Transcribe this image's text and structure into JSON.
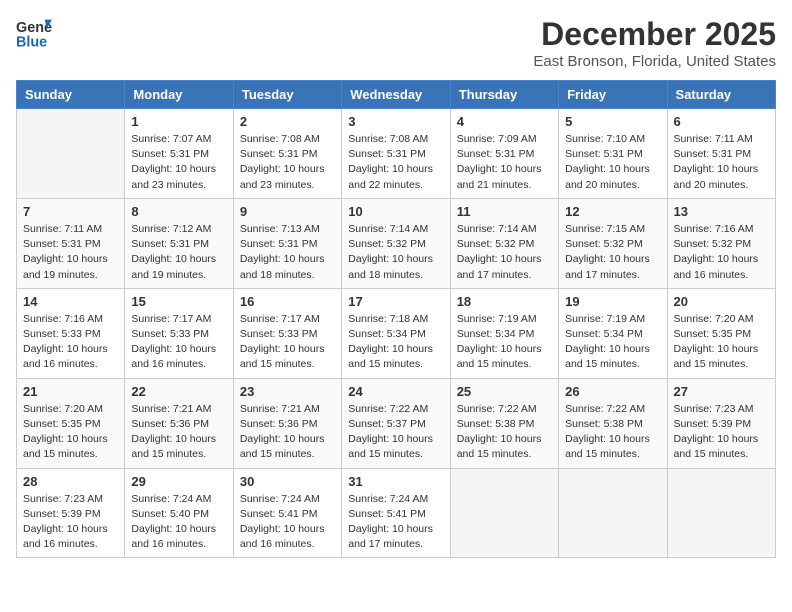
{
  "header": {
    "logo_line1": "General",
    "logo_line2": "Blue",
    "month": "December 2025",
    "location": "East Bronson, Florida, United States"
  },
  "days_of_week": [
    "Sunday",
    "Monday",
    "Tuesday",
    "Wednesday",
    "Thursday",
    "Friday",
    "Saturday"
  ],
  "weeks": [
    [
      {
        "num": "",
        "detail": ""
      },
      {
        "num": "1",
        "detail": "Sunrise: 7:07 AM\nSunset: 5:31 PM\nDaylight: 10 hours\nand 23 minutes."
      },
      {
        "num": "2",
        "detail": "Sunrise: 7:08 AM\nSunset: 5:31 PM\nDaylight: 10 hours\nand 23 minutes."
      },
      {
        "num": "3",
        "detail": "Sunrise: 7:08 AM\nSunset: 5:31 PM\nDaylight: 10 hours\nand 22 minutes."
      },
      {
        "num": "4",
        "detail": "Sunrise: 7:09 AM\nSunset: 5:31 PM\nDaylight: 10 hours\nand 21 minutes."
      },
      {
        "num": "5",
        "detail": "Sunrise: 7:10 AM\nSunset: 5:31 PM\nDaylight: 10 hours\nand 20 minutes."
      },
      {
        "num": "6",
        "detail": "Sunrise: 7:11 AM\nSunset: 5:31 PM\nDaylight: 10 hours\nand 20 minutes."
      }
    ],
    [
      {
        "num": "7",
        "detail": "Sunrise: 7:11 AM\nSunset: 5:31 PM\nDaylight: 10 hours\nand 19 minutes."
      },
      {
        "num": "8",
        "detail": "Sunrise: 7:12 AM\nSunset: 5:31 PM\nDaylight: 10 hours\nand 19 minutes."
      },
      {
        "num": "9",
        "detail": "Sunrise: 7:13 AM\nSunset: 5:31 PM\nDaylight: 10 hours\nand 18 minutes."
      },
      {
        "num": "10",
        "detail": "Sunrise: 7:14 AM\nSunset: 5:32 PM\nDaylight: 10 hours\nand 18 minutes."
      },
      {
        "num": "11",
        "detail": "Sunrise: 7:14 AM\nSunset: 5:32 PM\nDaylight: 10 hours\nand 17 minutes."
      },
      {
        "num": "12",
        "detail": "Sunrise: 7:15 AM\nSunset: 5:32 PM\nDaylight: 10 hours\nand 17 minutes."
      },
      {
        "num": "13",
        "detail": "Sunrise: 7:16 AM\nSunset: 5:32 PM\nDaylight: 10 hours\nand 16 minutes."
      }
    ],
    [
      {
        "num": "14",
        "detail": "Sunrise: 7:16 AM\nSunset: 5:33 PM\nDaylight: 10 hours\nand 16 minutes."
      },
      {
        "num": "15",
        "detail": "Sunrise: 7:17 AM\nSunset: 5:33 PM\nDaylight: 10 hours\nand 16 minutes."
      },
      {
        "num": "16",
        "detail": "Sunrise: 7:17 AM\nSunset: 5:33 PM\nDaylight: 10 hours\nand 15 minutes."
      },
      {
        "num": "17",
        "detail": "Sunrise: 7:18 AM\nSunset: 5:34 PM\nDaylight: 10 hours\nand 15 minutes."
      },
      {
        "num": "18",
        "detail": "Sunrise: 7:19 AM\nSunset: 5:34 PM\nDaylight: 10 hours\nand 15 minutes."
      },
      {
        "num": "19",
        "detail": "Sunrise: 7:19 AM\nSunset: 5:34 PM\nDaylight: 10 hours\nand 15 minutes."
      },
      {
        "num": "20",
        "detail": "Sunrise: 7:20 AM\nSunset: 5:35 PM\nDaylight: 10 hours\nand 15 minutes."
      }
    ],
    [
      {
        "num": "21",
        "detail": "Sunrise: 7:20 AM\nSunset: 5:35 PM\nDaylight: 10 hours\nand 15 minutes."
      },
      {
        "num": "22",
        "detail": "Sunrise: 7:21 AM\nSunset: 5:36 PM\nDaylight: 10 hours\nand 15 minutes."
      },
      {
        "num": "23",
        "detail": "Sunrise: 7:21 AM\nSunset: 5:36 PM\nDaylight: 10 hours\nand 15 minutes."
      },
      {
        "num": "24",
        "detail": "Sunrise: 7:22 AM\nSunset: 5:37 PM\nDaylight: 10 hours\nand 15 minutes."
      },
      {
        "num": "25",
        "detail": "Sunrise: 7:22 AM\nSunset: 5:38 PM\nDaylight: 10 hours\nand 15 minutes."
      },
      {
        "num": "26",
        "detail": "Sunrise: 7:22 AM\nSunset: 5:38 PM\nDaylight: 10 hours\nand 15 minutes."
      },
      {
        "num": "27",
        "detail": "Sunrise: 7:23 AM\nSunset: 5:39 PM\nDaylight: 10 hours\nand 15 minutes."
      }
    ],
    [
      {
        "num": "28",
        "detail": "Sunrise: 7:23 AM\nSunset: 5:39 PM\nDaylight: 10 hours\nand 16 minutes."
      },
      {
        "num": "29",
        "detail": "Sunrise: 7:24 AM\nSunset: 5:40 PM\nDaylight: 10 hours\nand 16 minutes."
      },
      {
        "num": "30",
        "detail": "Sunrise: 7:24 AM\nSunset: 5:41 PM\nDaylight: 10 hours\nand 16 minutes."
      },
      {
        "num": "31",
        "detail": "Sunrise: 7:24 AM\nSunset: 5:41 PM\nDaylight: 10 hours\nand 17 minutes."
      },
      {
        "num": "",
        "detail": ""
      },
      {
        "num": "",
        "detail": ""
      },
      {
        "num": "",
        "detail": ""
      }
    ]
  ]
}
